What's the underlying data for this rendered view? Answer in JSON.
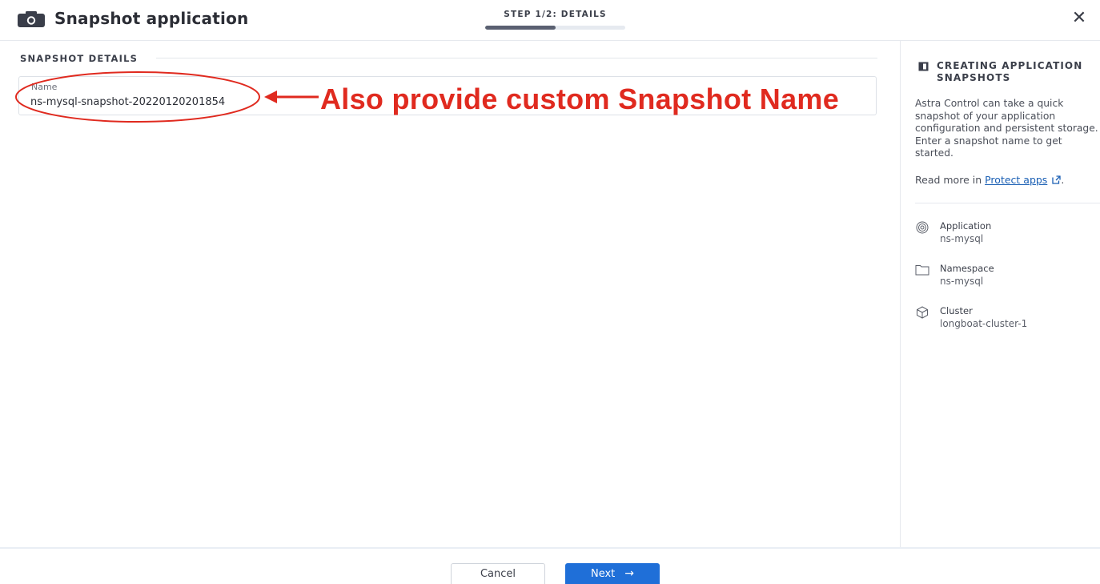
{
  "header": {
    "title": "Snapshot application",
    "step_label": "STEP 1/2: DETAILS",
    "progress_fraction": 0.5,
    "close_glyph": "✕",
    "camera_icon": "camera-icon"
  },
  "main": {
    "section_title": "SNAPSHOT DETAILS",
    "name_field": {
      "label": "Name",
      "value": "ns-mysql-snapshot-20220120201854"
    },
    "annotation": "Also provide custom Snapshot Name"
  },
  "panel": {
    "title": "CREATING APPLICATION SNAPSHOTS",
    "description": "Astra Control can take a quick snapshot of your application configuration and persistent storage. Enter a snapshot name to get started.",
    "read_more_prefix": "Read more in ",
    "read_more_link": "Protect apps",
    "read_more_suffix": ".",
    "items": [
      {
        "label": "Application",
        "value": "ns-mysql",
        "icon": "application-icon"
      },
      {
        "label": "Namespace",
        "value": "ns-mysql",
        "icon": "folder-icon"
      },
      {
        "label": "Cluster",
        "value": "longboat-cluster-1",
        "icon": "cluster-icon"
      }
    ]
  },
  "footer": {
    "cancel_label": "Cancel",
    "next_label": "Next",
    "next_arrow": "→"
  },
  "colors": {
    "accent": "#1f6fd8",
    "annotation": "#e02a1f",
    "link": "#1a5fb4"
  }
}
